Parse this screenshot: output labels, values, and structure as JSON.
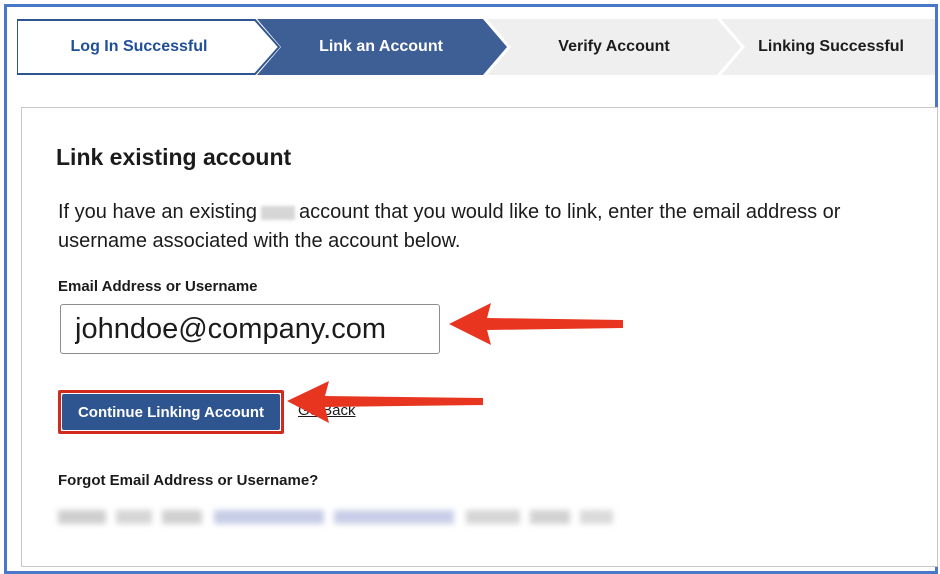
{
  "stepper": {
    "steps": [
      {
        "label": "Log In Successful",
        "state": "done"
      },
      {
        "label": "Link an Account",
        "state": "current"
      },
      {
        "label": "Verify Account",
        "state": "upcoming"
      },
      {
        "label": "Linking Successful",
        "state": "upcoming"
      }
    ]
  },
  "card": {
    "title": "Link existing account",
    "desc_part1": "If you have an existing",
    "desc_part2": "account that you would like to link, enter the email address or username associated with the account below.",
    "field_label": "Email Address or Username",
    "field_value": "johndoe@company.com",
    "continue_label": "Continue Linking Account",
    "go_back_label": "Go Back",
    "forgot_label": "Forgot Email Address or Username?"
  },
  "colors": {
    "frame": "#4a78c8",
    "step_current": "#3e5f96",
    "step_inactive": "#efefef",
    "button": "#2f5591",
    "highlight": "#d32a1d",
    "arrow": "#e8351f"
  }
}
